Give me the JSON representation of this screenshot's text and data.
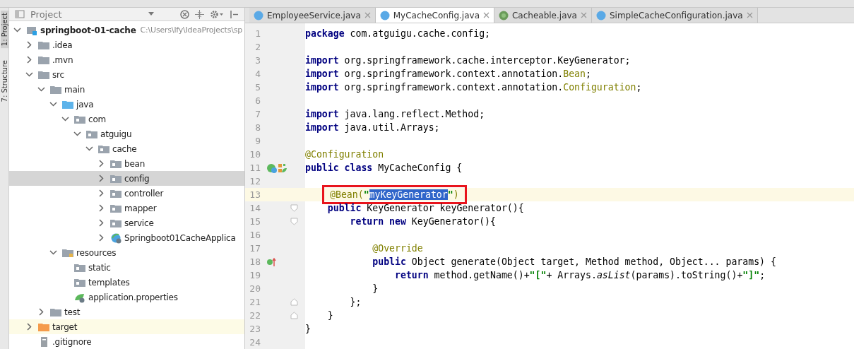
{
  "side_strip": [
    {
      "label": "1: Project",
      "selected": true
    },
    {
      "label": "7: Structure",
      "selected": false
    }
  ],
  "project_panel": {
    "title": "Project",
    "tree": [
      {
        "label": "springboot-01-cache",
        "path": "C:\\Users\\lfy\\IdeaProjects\\sp",
        "kind": "module",
        "expanded": true,
        "selected": false,
        "children": [
          {
            "label": ".idea",
            "kind": "folder",
            "expanded": false,
            "selected": false
          },
          {
            "label": ".mvn",
            "kind": "folder",
            "expanded": false,
            "selected": false
          },
          {
            "label": "src",
            "kind": "folder",
            "expanded": true,
            "selected": false,
            "children": [
              {
                "label": "main",
                "kind": "folder",
                "expanded": true,
                "selected": false,
                "children": [
                  {
                    "label": "java",
                    "kind": "source",
                    "expanded": true,
                    "selected": false,
                    "children": [
                      {
                        "label": "com",
                        "kind": "package",
                        "expanded": true,
                        "selected": false,
                        "children": [
                          {
                            "label": "atguigu",
                            "kind": "package",
                            "expanded": true,
                            "selected": false,
                            "children": [
                              {
                                "label": "cache",
                                "kind": "package",
                                "expanded": true,
                                "selected": false,
                                "children": [
                                  {
                                    "label": "bean",
                                    "kind": "package",
                                    "expanded": false,
                                    "selected": false
                                  },
                                  {
                                    "label": "config",
                                    "kind": "package",
                                    "expanded": false,
                                    "selected": true
                                  },
                                  {
                                    "label": "controller",
                                    "kind": "package",
                                    "expanded": false,
                                    "selected": false
                                  },
                                  {
                                    "label": "mapper",
                                    "kind": "package",
                                    "expanded": false,
                                    "selected": false
                                  },
                                  {
                                    "label": "service",
                                    "kind": "package",
                                    "expanded": false,
                                    "selected": false
                                  },
                                  {
                                    "label": "Springboot01CacheApplica",
                                    "kind": "spring-class",
                                    "expanded": false,
                                    "selected": false
                                  }
                                ]
                              }
                            ]
                          }
                        ]
                      }
                    ]
                  },
                  {
                    "label": "resources",
                    "kind": "resources",
                    "expanded": true,
                    "selected": false,
                    "children": [
                      {
                        "label": "static",
                        "kind": "package",
                        "selected": false
                      },
                      {
                        "label": "templates",
                        "kind": "package",
                        "selected": false
                      },
                      {
                        "label": "application.properties",
                        "kind": "spring-file",
                        "selected": false
                      }
                    ]
                  }
                ]
              },
              {
                "label": "test",
                "kind": "folder",
                "expanded": false,
                "selected": false
              }
            ]
          },
          {
            "label": "target",
            "kind": "excluded",
            "expanded": false,
            "selected": false
          },
          {
            "label": ".gitignore",
            "kind": "file",
            "selected": false
          }
        ]
      }
    ]
  },
  "tabs": [
    {
      "label": "EmployeeService.java",
      "kind": "class",
      "selected": false
    },
    {
      "label": "MyCacheConfig.java",
      "kind": "class",
      "selected": true
    },
    {
      "label": "Cacheable.java",
      "kind": "annotation",
      "selected": false
    },
    {
      "label": "SimpleCacheConfiguration.java",
      "kind": "class",
      "selected": false
    }
  ],
  "editor": {
    "lines": [
      {
        "number": "1",
        "tokens": [
          {
            "kind": "keyword",
            "text": "package"
          },
          {
            "kind": "plain",
            "text": " com.atguigu.cache.config;"
          }
        ]
      },
      {
        "number": "2"
      },
      {
        "number": "3",
        "tokens": [
          {
            "kind": "keyword",
            "text": "import"
          },
          {
            "kind": "plain",
            "text": " org.springframework.cache.interceptor.KeyGenerator;"
          }
        ]
      },
      {
        "number": "4",
        "tokens": [
          {
            "kind": "keyword",
            "text": "import"
          },
          {
            "kind": "plain",
            "text": " org.springframework.context.annotation."
          },
          {
            "kind": "annotation",
            "text": "Bean"
          },
          {
            "kind": "plain",
            "text": ";"
          }
        ]
      },
      {
        "number": "5",
        "tokens": [
          {
            "kind": "keyword",
            "text": "import"
          },
          {
            "kind": "plain",
            "text": " org.springframework.context.annotation."
          },
          {
            "kind": "annotation",
            "text": "Configuration"
          },
          {
            "kind": "plain",
            "text": ";"
          }
        ]
      },
      {
        "number": "6"
      },
      {
        "number": "7",
        "tokens": [
          {
            "kind": "keyword",
            "text": "import"
          },
          {
            "kind": "plain",
            "text": " java.lang.reflect.Method;"
          }
        ]
      },
      {
        "number": "8",
        "tokens": [
          {
            "kind": "keyword",
            "text": "import"
          },
          {
            "kind": "plain",
            "text": " java.util.Arrays;"
          }
        ]
      },
      {
        "number": "9"
      },
      {
        "number": "10",
        "tokens": [
          {
            "kind": "annotation",
            "text": "@Configuration"
          }
        ]
      },
      {
        "number": "11",
        "kind": "bean-class",
        "tokens": [
          {
            "kind": "keyword",
            "text": "public class"
          },
          {
            "kind": "plain",
            "text": " MyCacheConfig {"
          }
        ]
      },
      {
        "number": "12"
      },
      {
        "number": "13",
        "current": true,
        "boxed": true,
        "tokens": [
          {
            "kind": "annotation",
            "text": "@Bean("
          },
          {
            "kind": "string",
            "text": "\""
          },
          {
            "kind": "selection",
            "text": "myKeyGenerator"
          },
          {
            "kind": "string",
            "text": "\""
          },
          {
            "kind": "annotation",
            "text": ")"
          }
        ]
      },
      {
        "number": "14",
        "kind": "fold-start",
        "tokens": [
          {
            "kind": "keyword",
            "text": "    public"
          },
          {
            "kind": "plain",
            "text": " KeyGenerator keyGenerator(){"
          }
        ]
      },
      {
        "number": "15",
        "kind": "fold-start",
        "tokens": [
          {
            "kind": "keyword",
            "text": "        return new"
          },
          {
            "kind": "plain",
            "text": " KeyGenerator(){"
          }
        ]
      },
      {
        "number": "16"
      },
      {
        "number": "17",
        "tokens": [
          {
            "kind": "annotation",
            "text": "            @Override"
          }
        ]
      },
      {
        "number": "18",
        "kind": "override",
        "tokens": [
          {
            "kind": "keyword",
            "text": "            public"
          },
          {
            "kind": "plain",
            "text": " Object generate(Object target, Method method, Object... params) {"
          }
        ]
      },
      {
        "number": "19",
        "tokens": [
          {
            "kind": "keyword",
            "text": "                return"
          },
          {
            "kind": "plain",
            "text": " method.getName()+"
          },
          {
            "kind": "string",
            "text": "\"[\""
          },
          {
            "kind": "plain",
            "text": "+ Arrays."
          },
          {
            "kind": "italic",
            "text": "asList"
          },
          {
            "kind": "plain",
            "text": "(params).toString()+"
          },
          {
            "kind": "string",
            "text": "\"]\""
          },
          {
            "kind": "plain",
            "text": ";"
          }
        ]
      },
      {
        "number": "20",
        "tokens": [
          {
            "kind": "plain",
            "text": "            }"
          }
        ]
      },
      {
        "number": "21",
        "kind": "fold-end",
        "tokens": [
          {
            "kind": "plain",
            "text": "        };"
          }
        ]
      },
      {
        "number": "22",
        "kind": "fold-end",
        "tokens": [
          {
            "kind": "plain",
            "text": "    }"
          }
        ]
      },
      {
        "number": "23",
        "tokens": [
          {
            "kind": "plain",
            "text": "}"
          }
        ]
      },
      {
        "number": "24"
      }
    ]
  }
}
